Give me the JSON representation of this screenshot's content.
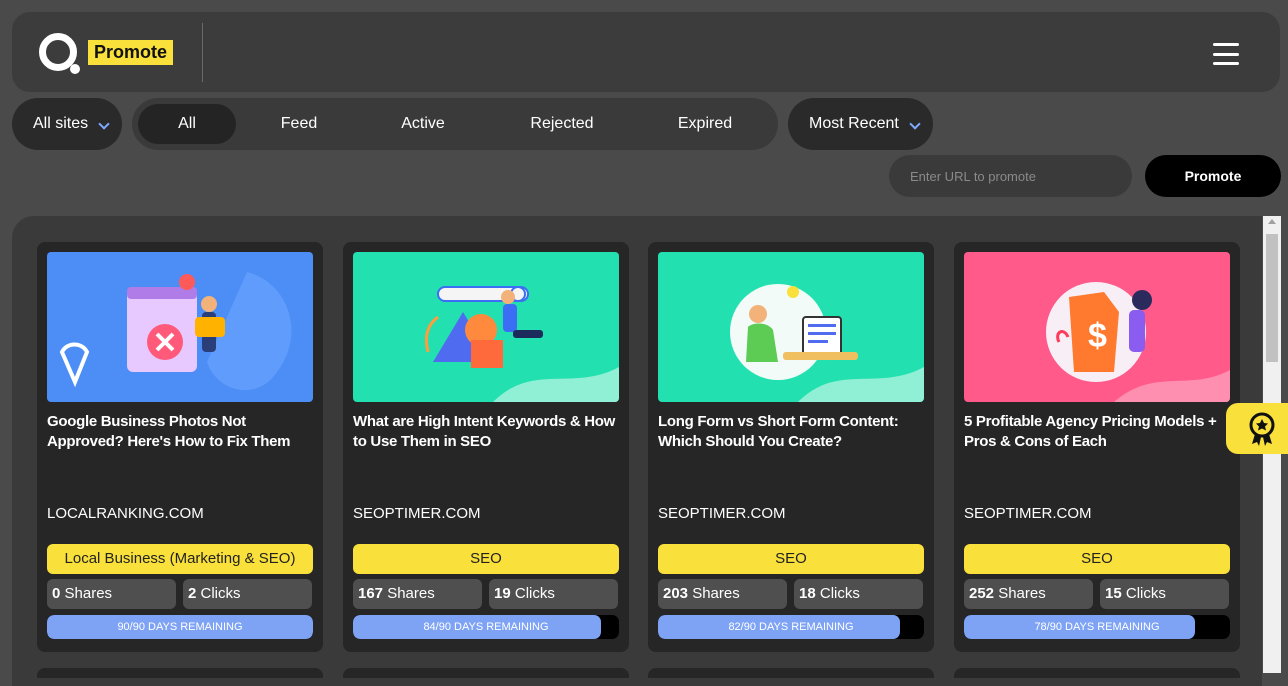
{
  "header": {
    "logo_text": "Promote"
  },
  "filters": {
    "sites_label": "All sites",
    "tabs": [
      "All",
      "Feed",
      "Active",
      "Rejected",
      "Expired"
    ],
    "active_tab": "All",
    "sort_label": "Most Recent"
  },
  "promote": {
    "placeholder": "Enter URL to promote",
    "button_label": "Promote"
  },
  "cards": [
    {
      "title": "Google Business Photos Not Approved? Here's How to Fix Them",
      "domain": "LOCALRANKING.COM",
      "tag": "Local Business (Marketing & SEO)",
      "shares": "0",
      "shares_label": "Shares",
      "clicks": "2",
      "clicks_label": "Clicks",
      "days_text": "90/90 DAYS REMAINING",
      "days_remaining": 90,
      "days_total": 90,
      "thumb_color": "#4d8ef6"
    },
    {
      "title": "What are High Intent Keywords & How to Use Them in SEO",
      "domain": "SEOPTIMER.COM",
      "tag": "SEO",
      "shares": "167",
      "shares_label": "Shares",
      "clicks": "19",
      "clicks_label": "Clicks",
      "days_text": "84/90 DAYS REMAINING",
      "days_remaining": 84,
      "days_total": 90,
      "thumb_color": "#22e0b0"
    },
    {
      "title": "Long Form vs Short Form Content: Which Should You Create?",
      "domain": "SEOPTIMER.COM",
      "tag": "SEO",
      "shares": "203",
      "shares_label": "Shares",
      "clicks": "18",
      "clicks_label": "Clicks",
      "days_text": "82/90 DAYS REMAINING",
      "days_remaining": 82,
      "days_total": 90,
      "thumb_color": "#22e0b0"
    },
    {
      "title": "5 Profitable Agency Pricing Models + Pros & Cons of Each",
      "domain": "SEOPTIMER.COM",
      "tag": "SEO",
      "shares": "252",
      "shares_label": "Shares",
      "clicks": "15",
      "clicks_label": "Clicks",
      "days_text": "78/90 DAYS REMAINING",
      "days_remaining": 78,
      "days_total": 90,
      "thumb_color": "#ff5a8a"
    }
  ]
}
